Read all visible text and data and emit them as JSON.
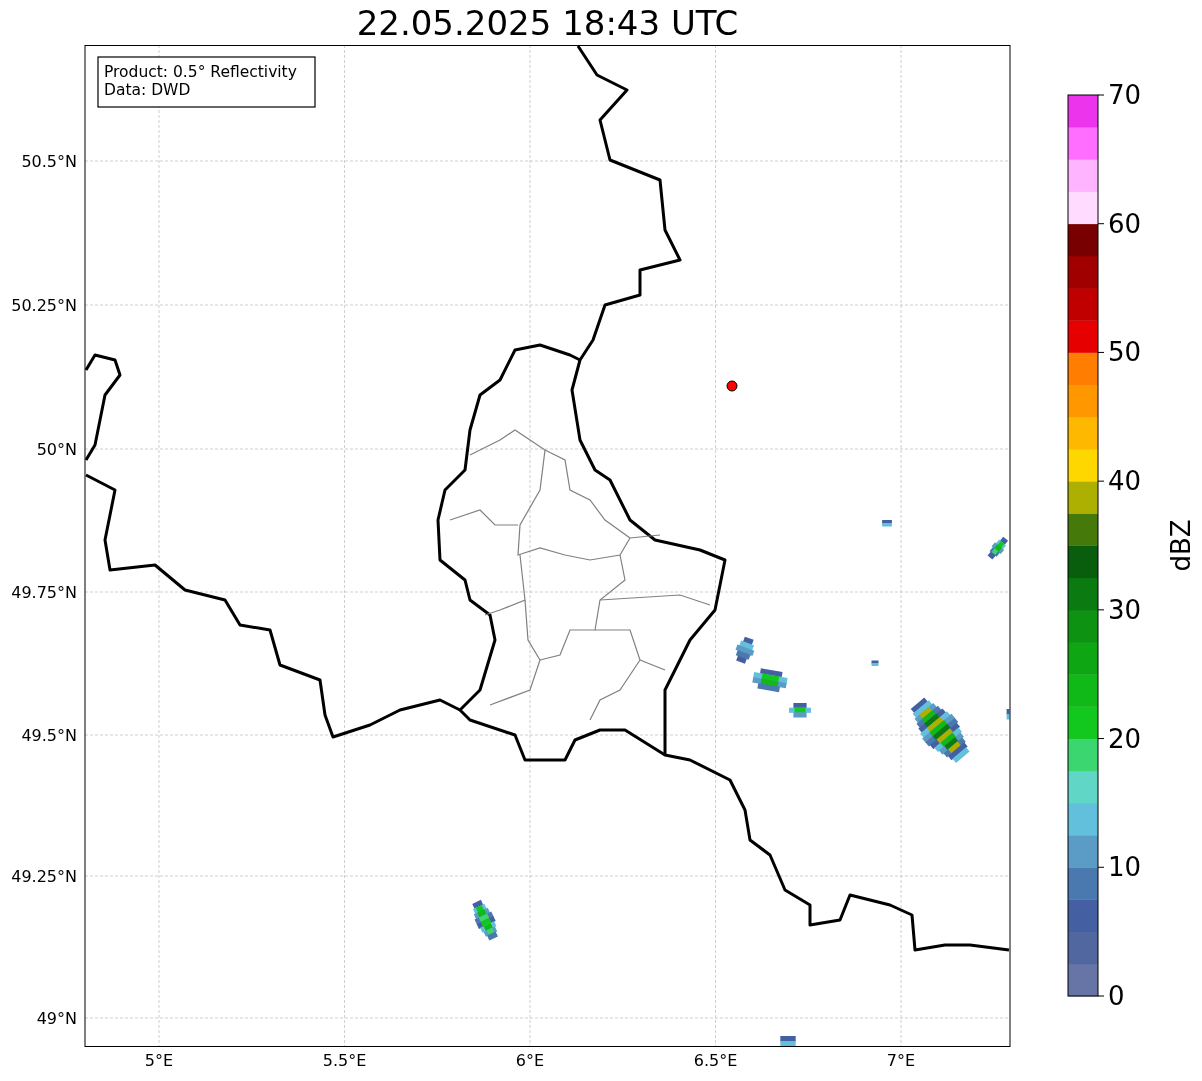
{
  "title": "22.05.2025 18:43 UTC",
  "info_box": {
    "lines": [
      "Product: 0.5° Reflectivity",
      "Data: DWD"
    ]
  },
  "map": {
    "lat_ticks": [
      "50.5°N",
      "50.25°N",
      "50°N",
      "49.75°N",
      "49.5°N",
      "49.25°N",
      "49°N"
    ],
    "lon_ticks": [
      "5°E",
      "5.5°E",
      "6°E",
      "6.5°E",
      "7°E"
    ]
  },
  "colorbar": {
    "label": "dBZ",
    "ticks": [
      "70",
      "60",
      "50",
      "40",
      "30",
      "20",
      "10",
      "0"
    ],
    "bins": [
      {
        "color": "#6674a6"
      },
      {
        "color": "#51679f"
      },
      {
        "color": "#4460a2"
      },
      {
        "color": "#4a79b0"
      },
      {
        "color": "#5a9cc5"
      },
      {
        "color": "#63c0dc"
      },
      {
        "color": "#60d6c6"
      },
      {
        "color": "#3cd670"
      },
      {
        "color": "#12c81e"
      },
      {
        "color": "#10b818"
      },
      {
        "color": "#0fa614"
      },
      {
        "color": "#0d9212"
      },
      {
        "color": "#0b7a10"
      },
      {
        "color": "#085e0c"
      },
      {
        "color": "#457a0a"
      },
      {
        "color": "#adb000"
      },
      {
        "color": "#ffd700"
      },
      {
        "color": "#ffb800"
      },
      {
        "color": "#ff9800"
      },
      {
        "color": "#ff7d00"
      },
      {
        "color": "#e60000"
      },
      {
        "color": "#c00000"
      },
      {
        "color": "#a00000"
      },
      {
        "color": "#780000"
      },
      {
        "color": "#ffdcff"
      },
      {
        "color": "#ffb4ff"
      },
      {
        "color": "#ff6eff"
      },
      {
        "color": "#ec34ec"
      }
    ]
  }
}
